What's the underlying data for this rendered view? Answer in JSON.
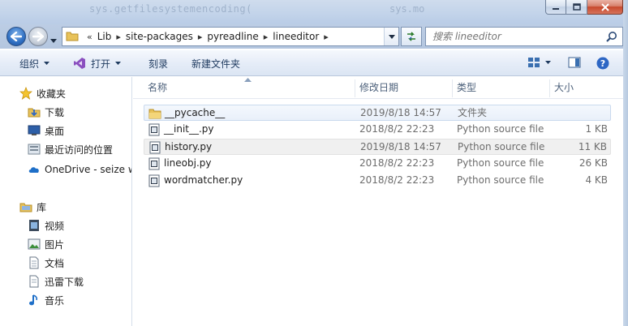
{
  "window": {
    "background_text_left": "sys.getfilesystemencoding(",
    "background_text_right": "sys.mo"
  },
  "address": {
    "overflow": "«",
    "crumbs": [
      "Lib",
      "site-packages",
      "pyreadline",
      "lineeditor"
    ]
  },
  "search": {
    "placeholder": "搜索 lineeditor"
  },
  "toolbar": {
    "organize_label": "组织",
    "open_label": "打开",
    "burn_label": "刻录",
    "new_folder_label": "新建文件夹"
  },
  "nav": {
    "favorites_label": "收藏夹",
    "favorites": [
      {
        "label": "下载",
        "icon": "download-folder-icon"
      },
      {
        "label": "桌面",
        "icon": "desktop-icon"
      },
      {
        "label": "最近访问的位置",
        "icon": "recent-places-icon"
      }
    ],
    "onedrive_label": "OneDrive - seize w",
    "libraries_label": "库",
    "libraries": [
      {
        "label": "视频",
        "icon": "video-icon"
      },
      {
        "label": "图片",
        "icon": "pictures-icon"
      },
      {
        "label": "文档",
        "icon": "documents-icon"
      },
      {
        "label": "迅雷下载",
        "icon": "thunder-download-icon"
      },
      {
        "label": "音乐",
        "icon": "music-icon"
      }
    ]
  },
  "columns": {
    "name": "名称",
    "date": "修改日期",
    "type": "类型",
    "size": "大小"
  },
  "files": [
    {
      "name": "__pycache__",
      "date": "2019/8/18 14:57",
      "type": "文件夹",
      "size": "",
      "icon": "folder-icon"
    },
    {
      "name": "__init__.py",
      "date": "2018/8/2 22:23",
      "type": "Python source file",
      "size": "1 KB",
      "icon": "python-file-icon"
    },
    {
      "name": "history.py",
      "date": "2019/8/18 14:57",
      "type": "Python source file",
      "size": "11 KB",
      "icon": "python-file-icon"
    },
    {
      "name": "lineobj.py",
      "date": "2018/8/2 22:23",
      "type": "Python source file",
      "size": "26 KB",
      "icon": "python-file-icon"
    },
    {
      "name": "wordmatcher.py",
      "date": "2018/8/2 22:23",
      "type": "Python source file",
      "size": "4 KB",
      "icon": "python-file-icon"
    }
  ],
  "colors": {
    "accent": "#1e3a5f",
    "selection_border": "#c9d9ee",
    "header_text": "#4c607a"
  }
}
